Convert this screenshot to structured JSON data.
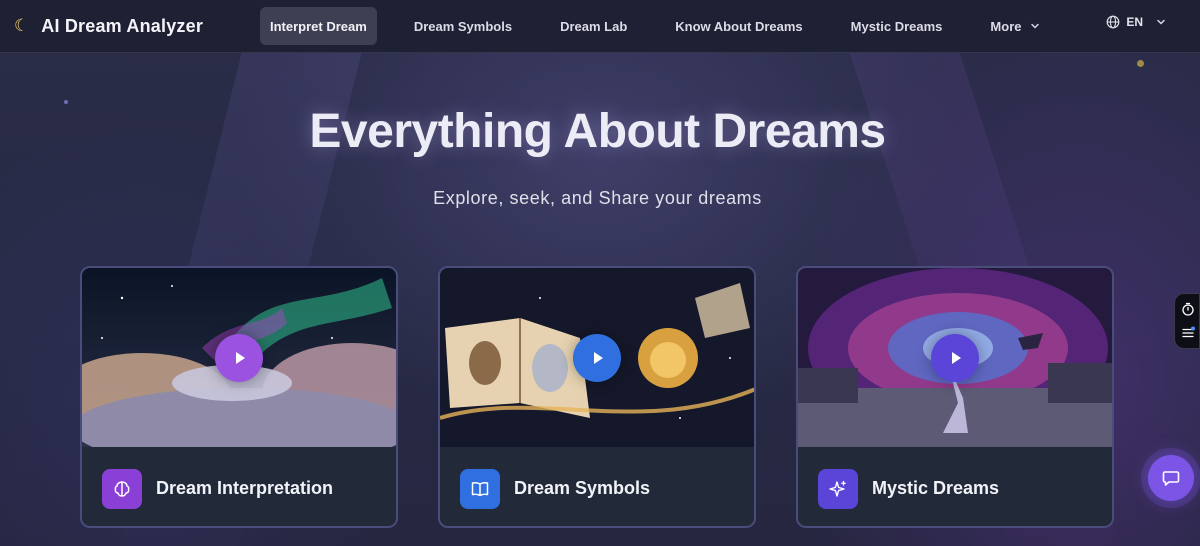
{
  "nav": {
    "brand": {
      "icon": "crescent-moon-icon",
      "name": "AI Dream Analyzer"
    },
    "items": [
      {
        "label": "Interpret Dream",
        "active": true
      },
      {
        "label": "Dream Symbols",
        "active": false
      },
      {
        "label": "Dream Lab",
        "active": false
      },
      {
        "label": "Know About Dreams",
        "active": false
      },
      {
        "label": "Mystic Dreams",
        "active": false
      },
      {
        "label": "More",
        "active": false
      }
    ],
    "language": "EN"
  },
  "hero": {
    "title": "Everything About Dreams",
    "subtitle": "Explore, seek, and Share your dreams"
  },
  "cards": [
    {
      "label": "Dream Interpretation",
      "icon": "brain-icon",
      "accent": "#8a3fd6"
    },
    {
      "label": "Dream Symbols",
      "icon": "open-book-icon",
      "accent": "#2f6fe0"
    },
    {
      "label": "Mystic Dreams",
      "icon": "sparkles-icon",
      "accent": "#5a45d8"
    }
  ],
  "colors": {
    "background": "#262842",
    "nav_background": "#1e2033",
    "card_border": "#4a4d7c",
    "chat_button": "#7c55e6"
  }
}
